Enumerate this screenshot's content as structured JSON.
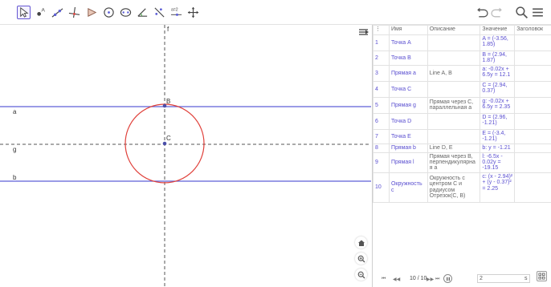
{
  "toolbar": {
    "tools": [
      {
        "name": "move-tool-icon",
        "active": true
      },
      {
        "name": "point-tool-icon"
      },
      {
        "name": "line-tool-icon"
      },
      {
        "name": "perpendicular-line-tool-icon"
      },
      {
        "name": "polygon-tool-icon"
      },
      {
        "name": "circle-center-point-tool-icon"
      },
      {
        "name": "ellipse-tool-icon"
      },
      {
        "name": "angle-tool-icon"
      },
      {
        "name": "reflect-tool-icon"
      },
      {
        "name": "slider-tool-icon",
        "label": "a=2"
      },
      {
        "name": "move-graphics-view-tool-icon"
      }
    ],
    "right_icons": [
      "undo-icon",
      "redo-icon",
      "search-icon",
      "menu-icon"
    ]
  },
  "graphics": {
    "colors": {
      "line": "#5d5fd6",
      "circle": "#e0403a",
      "axis": "#555555",
      "point": "#4a4ea8"
    },
    "labels": {
      "line_a": "a",
      "line_g": "g",
      "line_b": "b",
      "axis_f": "f",
      "point_B": "B",
      "point_C": "C"
    },
    "buttons": [
      "home-icon",
      "zoom-in-icon",
      "zoom-out-icon"
    ]
  },
  "algebra": {
    "headers": {
      "num": "",
      "name": "Имя",
      "desc": "Описание",
      "value": "Значение",
      "caption": "Заголовок"
    },
    "rows": [
      {
        "num": "1",
        "name": "Точка A",
        "desc": "",
        "value": "A = (-3.56, 1.85)"
      },
      {
        "num": "2",
        "name": "Точка B",
        "desc": "",
        "value": "B = (2.94, 1.87)"
      },
      {
        "num": "3",
        "name": "Прямая a",
        "desc": "Line A, B",
        "value": "a: -0.02x + 6.5y = 12.1"
      },
      {
        "num": "4",
        "name": "Точка C",
        "desc": "",
        "value": "C = (2.94, 0.37)"
      },
      {
        "num": "5",
        "name": "Прямая g",
        "desc": "Прямая через C, параллельная a",
        "value": "g: -0.02x + 6.5y = 2.35"
      },
      {
        "num": "6",
        "name": "Точка D",
        "desc": "",
        "value": "D = (2.96, -1.21)"
      },
      {
        "num": "7",
        "name": "Точка E",
        "desc": "",
        "value": "E = (-3.4, -1.21)"
      },
      {
        "num": "8",
        "name": "Прямая b",
        "desc": "Line D, E",
        "value": "b: y = -1.21"
      },
      {
        "num": "9",
        "name": "Прямая l",
        "desc": "Прямая через B, перпендикулярная a",
        "value": "l: -6.5x - 0.02y = -19.15"
      },
      {
        "num": "10",
        "name": "Окружность c",
        "desc": "Окружность с центром C и радиусом Отрезок(C, B)",
        "value": "c: (x - 2.94)² + (y - 0.37)² = 2.25"
      }
    ]
  },
  "navigation": {
    "count": "10 / 10",
    "speed_value": "2",
    "speed_unit": "s"
  }
}
